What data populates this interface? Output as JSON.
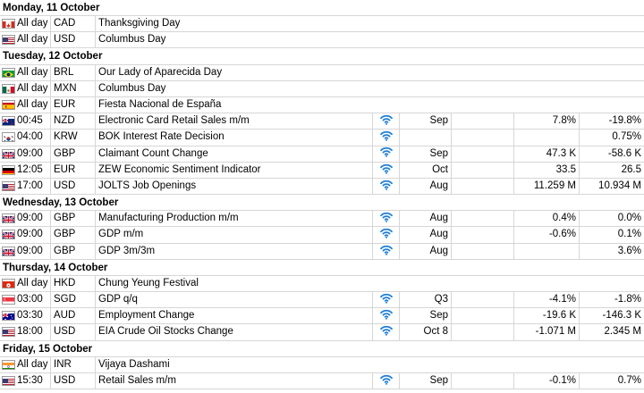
{
  "days": [
    {
      "title": "Monday, 11 October",
      "events": [
        {
          "time": "All day",
          "currency": "CAD",
          "event": "Thanksgiving Day",
          "flag": "ca",
          "all_day": true
        },
        {
          "time": "All day",
          "currency": "USD",
          "event": "Columbus Day",
          "flag": "us",
          "all_day": true
        }
      ]
    },
    {
      "title": "Tuesday, 12 October",
      "events": [
        {
          "time": "All day",
          "currency": "BRL",
          "event": "Our Lady of Aparecida Day",
          "flag": "br",
          "all_day": true
        },
        {
          "time": "All day",
          "currency": "MXN",
          "event": "Columbus Day",
          "flag": "mx",
          "all_day": true
        },
        {
          "time": "All day",
          "currency": "EUR",
          "event": "Fiesta Nacional de España",
          "flag": "es",
          "all_day": true
        },
        {
          "time": "00:45",
          "currency": "NZD",
          "event": "Electronic Card Retail Sales m/m",
          "flag": "nz",
          "period": "Sep",
          "actual": "",
          "forecast": "7.8%",
          "previous": "-19.8%",
          "icon": "signal-icon"
        },
        {
          "time": "04:00",
          "currency": "KRW",
          "event": "BOK Interest Rate Decision",
          "flag": "kr",
          "period": "",
          "actual": "",
          "forecast": "",
          "previous": "0.75%",
          "icon": "signal-icon"
        },
        {
          "time": "09:00",
          "currency": "GBP",
          "event": "Claimant Count Change",
          "flag": "gb",
          "period": "Sep",
          "actual": "",
          "forecast": "47.3 K",
          "previous": "-58.6 K",
          "icon": "signal-icon"
        },
        {
          "time": "12:05",
          "currency": "EUR",
          "event": "ZEW Economic Sentiment Indicator",
          "flag": "de",
          "period": "Oct",
          "actual": "",
          "forecast": "33.5",
          "previous": "26.5",
          "icon": "signal-icon"
        },
        {
          "time": "17:00",
          "currency": "USD",
          "event": "JOLTS Job Openings",
          "flag": "us",
          "period": "Aug",
          "actual": "",
          "forecast": "11.259 M",
          "previous": "10.934 M",
          "icon": "signal-icon"
        }
      ]
    },
    {
      "title": "Wednesday, 13 October",
      "events": [
        {
          "time": "09:00",
          "currency": "GBP",
          "event": "Manufacturing Production m/m",
          "flag": "gb",
          "period": "Aug",
          "actual": "",
          "forecast": "0.4%",
          "previous": "0.0%",
          "icon": "signal-icon"
        },
        {
          "time": "09:00",
          "currency": "GBP",
          "event": "GDP m/m",
          "flag": "gb",
          "period": "Aug",
          "actual": "",
          "forecast": "-0.6%",
          "previous": "0.1%",
          "icon": "signal-icon"
        },
        {
          "time": "09:00",
          "currency": "GBP",
          "event": "GDP 3m/3m",
          "flag": "gb",
          "period": "Aug",
          "actual": "",
          "forecast": "",
          "previous": "3.6%",
          "icon": "signal-icon"
        }
      ]
    },
    {
      "title": "Thursday, 14 October",
      "events": [
        {
          "time": "All day",
          "currency": "HKD",
          "event": "Chung Yeung Festival",
          "flag": "hk",
          "all_day": true
        },
        {
          "time": "03:00",
          "currency": "SGD",
          "event": "GDP q/q",
          "flag": "sg",
          "period": "Q3",
          "actual": "",
          "forecast": "-4.1%",
          "previous": "-1.8%",
          "icon": "signal-icon"
        },
        {
          "time": "03:30",
          "currency": "AUD",
          "event": "Employment Change",
          "flag": "au",
          "period": "Sep",
          "actual": "",
          "forecast": "-19.6 K",
          "previous": "-146.3 K",
          "icon": "signal-icon"
        },
        {
          "time": "18:00",
          "currency": "USD",
          "event": "EIA Crude Oil Stocks Change",
          "flag": "us",
          "period": "Oct 8",
          "actual": "",
          "forecast": "-1.071 M",
          "previous": "2.345 M",
          "icon": "signal-icon"
        }
      ]
    },
    {
      "title": "Friday, 15 October",
      "events": [
        {
          "time": "All day",
          "currency": "INR",
          "event": "Vijaya Dashami",
          "flag": "in",
          "all_day": true
        },
        {
          "time": "15:30",
          "currency": "USD",
          "event": "Retail Sales m/m",
          "flag": "us",
          "period": "Sep",
          "actual": "",
          "forecast": "-0.1%",
          "previous": "0.7%",
          "icon": "signal-icon"
        }
      ]
    }
  ],
  "colors": {
    "signal": "#1f7fd6",
    "grid": "#d6d6d6"
  }
}
